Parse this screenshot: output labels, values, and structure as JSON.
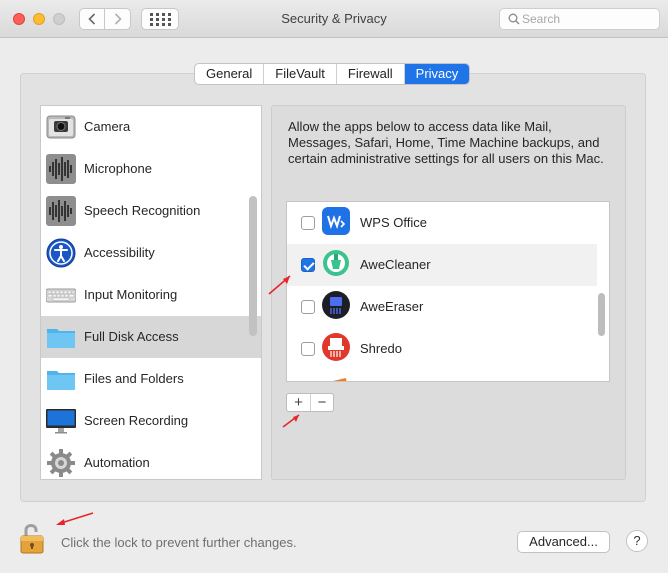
{
  "window": {
    "title": "Security & Privacy"
  },
  "search": {
    "placeholder": "Search"
  },
  "tabs": [
    {
      "label": "General",
      "active": false
    },
    {
      "label": "FileVault",
      "active": false
    },
    {
      "label": "Firewall",
      "active": false
    },
    {
      "label": "Privacy",
      "active": true
    }
  ],
  "categories": [
    {
      "label": "Camera",
      "icon": "camera-icon"
    },
    {
      "label": "Microphone",
      "icon": "microphone-icon"
    },
    {
      "label": "Speech Recognition",
      "icon": "speech-waveform-icon"
    },
    {
      "label": "Accessibility",
      "icon": "accessibility-icon"
    },
    {
      "label": "Input Monitoring",
      "icon": "keyboard-icon"
    },
    {
      "label": "Full Disk Access",
      "icon": "folder-icon",
      "selected": true
    },
    {
      "label": "Files and Folders",
      "icon": "folder-icon"
    },
    {
      "label": "Screen Recording",
      "icon": "display-icon"
    },
    {
      "label": "Automation",
      "icon": "gear-icon"
    }
  ],
  "privacy": {
    "description": "Allow the apps below to access data like Mail, Messages, Safari, Home, Time Machine backups, and certain administrative settings for all users on this Mac.",
    "apps": [
      {
        "label": "WPS Office",
        "checked": false,
        "icon": "wps-office-icon"
      },
      {
        "label": "AweCleaner",
        "checked": true,
        "icon": "awecleaner-icon"
      },
      {
        "label": "AweEraser",
        "checked": false,
        "icon": "aweeraser-icon"
      },
      {
        "label": "Shredo",
        "checked": false,
        "icon": "shredo-icon"
      }
    ],
    "add_label": "+",
    "remove_label": "−"
  },
  "footer": {
    "lock_text": "Click the lock to prevent further changes.",
    "advanced_label": "Advanced...",
    "help_label": "?"
  },
  "colors": {
    "accent": "#1f74e8",
    "annotation_arrow": "#e8262a"
  }
}
